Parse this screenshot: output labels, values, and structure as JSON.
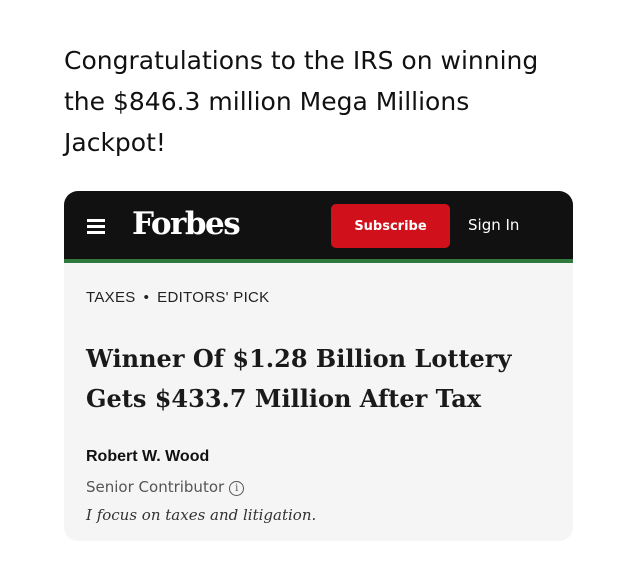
{
  "caption": {
    "line1": "Congratulations to the IRS on winning",
    "line2": "the $846.3 million Mega Millions",
    "line3": "Jackpot!"
  },
  "header": {
    "menu_icon": "hamburger-menu-icon",
    "logo": "Forbes",
    "subscribe_label": "Subscribe",
    "signin_label": "Sign In",
    "accent_color": "#d0101a",
    "divider_color": "#2f7a3c"
  },
  "article": {
    "kicker": {
      "section": "TAXES",
      "separator": "•",
      "tag": "EDITORS' PICK"
    },
    "headline": {
      "line1": "Winner Of $1.28 Billion Lottery",
      "line2": "Gets $433.7 Million After Tax"
    },
    "author": {
      "name": "Robert W. Wood",
      "role": "Senior Contributor",
      "info_icon": "info-icon",
      "bio": "I focus on taxes and litigation."
    }
  }
}
